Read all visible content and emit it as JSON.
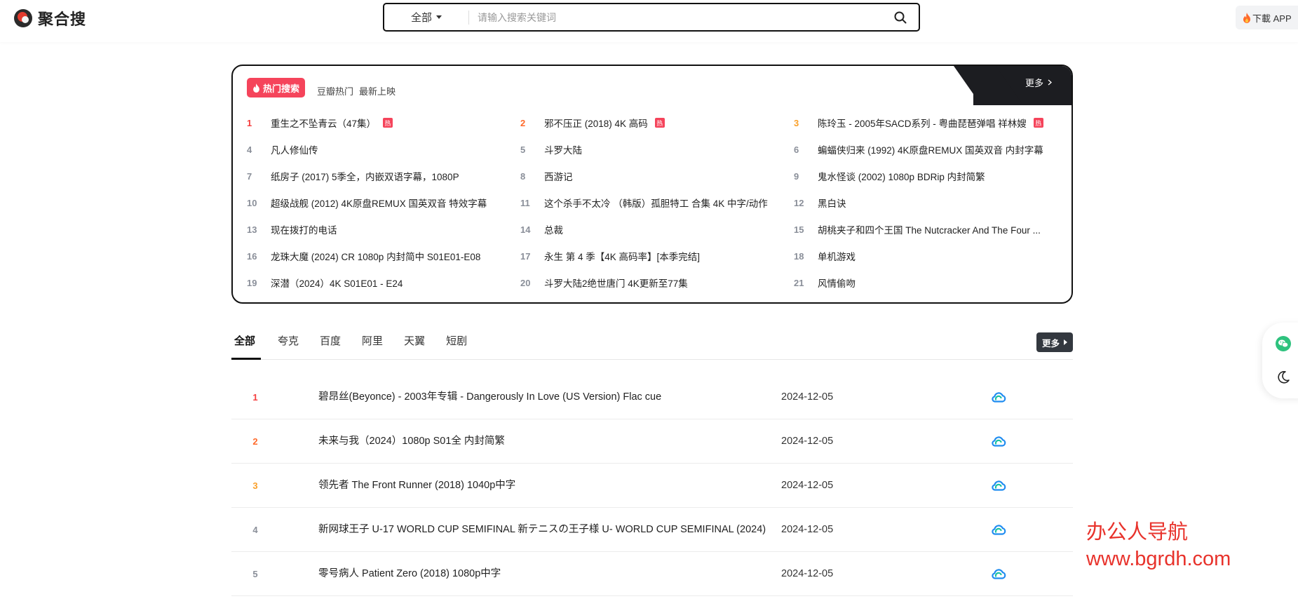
{
  "header": {
    "logo_text": "聚合搜",
    "search_category": "全部",
    "search_placeholder": "请输入搜索关键词",
    "download_label": "下載 APP"
  },
  "hot": {
    "badge": "热门搜索",
    "tabs": [
      "豆瓣热门",
      "最新上映"
    ],
    "more": "更多",
    "flag_text": "热",
    "items": [
      {
        "rank": "1",
        "title": "重生之不坠青云（47集）",
        "hot": true
      },
      {
        "rank": "2",
        "title": "邪不压正 (2018) 4K 高码",
        "hot": true
      },
      {
        "rank": "3",
        "title": "陈玲玉 - 2005年SACD系列 - 粤曲琵琶弹唱 祥林嫂",
        "hot": true
      },
      {
        "rank": "4",
        "title": "凡人修仙传",
        "hot": false
      },
      {
        "rank": "5",
        "title": "斗罗大陆",
        "hot": false
      },
      {
        "rank": "6",
        "title": "蝙蝠侠归来 (1992) 4K原盘REMUX 国英双音 内封字幕",
        "hot": false
      },
      {
        "rank": "7",
        "title": "纸房子 (2017) 5季全，内嵌双语字幕，1080P",
        "hot": false
      },
      {
        "rank": "8",
        "title": "西游记",
        "hot": false
      },
      {
        "rank": "9",
        "title": "鬼水怪谈 (2002) 1080p BDRip 内封简繁",
        "hot": false
      },
      {
        "rank": "10",
        "title": "超级战舰 (2012) 4K原盘REMUX 国英双音 特效字幕",
        "hot": false
      },
      {
        "rank": "11",
        "title": "这个杀手不太冷 （韩版）孤胆特工 合集 4K 中字/动作",
        "hot": false
      },
      {
        "rank": "12",
        "title": "黑白诀",
        "hot": false
      },
      {
        "rank": "13",
        "title": "现在拨打的电话",
        "hot": false
      },
      {
        "rank": "14",
        "title": "总裁",
        "hot": false
      },
      {
        "rank": "15",
        "title": "胡桃夹子和四个王国 The Nutcracker And The Four ...",
        "hot": false
      },
      {
        "rank": "16",
        "title": "龙珠大魔 (2024) CR 1080p 内封简中 S01E01-E08",
        "hot": false
      },
      {
        "rank": "17",
        "title": "永生 第 4 季【4K 高码率】[本季完结]",
        "hot": false
      },
      {
        "rank": "18",
        "title": "单机游戏",
        "hot": false
      },
      {
        "rank": "19",
        "title": "深潜（2024）4K S01E01 - E24",
        "hot": false
      },
      {
        "rank": "20",
        "title": "斗罗大陆2绝世唐门 4K更新至77集",
        "hot": false
      },
      {
        "rank": "21",
        "title": "风情偷吻",
        "hot": false
      }
    ]
  },
  "tabs": {
    "items": [
      "全部",
      "夸克",
      "百度",
      "阿里",
      "天翼",
      "短剧"
    ],
    "active": "全部",
    "more": "更多"
  },
  "results": [
    {
      "rank": "1",
      "title": "碧昂丝(Beyonce) - 2003年专辑 - Dangerously In Love (US Version) Flac cue",
      "date": "2024-12-05"
    },
    {
      "rank": "2",
      "title": "未来与我（2024）1080p S01全 内封简繁",
      "date": "2024-12-05"
    },
    {
      "rank": "3",
      "title": "领先者 The Front Runner (2018) 1040p中字",
      "date": "2024-12-05"
    },
    {
      "rank": "4",
      "title": "新网球王子 U-17 WORLD CUP SEMIFINAL 新テニスの王子様 U- WORLD CUP SEMIFINAL (2024)",
      "date": "2024-12-05"
    },
    {
      "rank": "5",
      "title": "零号病人 Patient Zero (2018) 1080p中字",
      "date": "2024-12-05"
    }
  ],
  "watermark": {
    "line1": "办公人导航",
    "line2": "www.bgrdh.com"
  },
  "colors": {
    "rank1": "#f53d3d",
    "rank2": "#ff6a2b",
    "rank3": "#faa02a",
    "hot_badge": "#f5445b",
    "dark": "#1c1d21",
    "watermark": "#e8322b"
  },
  "icons": {
    "search": "search-icon",
    "flame": "flame-icon",
    "cloud": "cloud-icon",
    "wechat": "wechat-icon",
    "moon": "moon-icon"
  }
}
